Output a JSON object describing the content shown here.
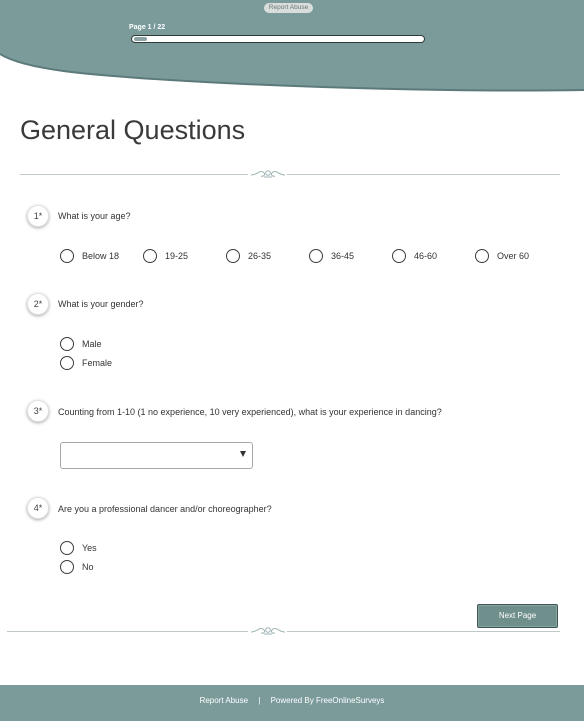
{
  "header": {
    "report_abuse": "Report Abuse",
    "page_label": "Page 1 / 22",
    "progress_fraction": 0.045
  },
  "title": "General Questions",
  "questions": [
    {
      "number": "1*",
      "text": "What is your age?",
      "options": [
        "Below 18",
        "19-25",
        "26-35",
        "36-45",
        "46-60",
        "Over 60"
      ]
    },
    {
      "number": "2*",
      "text": "What is your gender?",
      "options": [
        "Male",
        "Female"
      ]
    },
    {
      "number": "3*",
      "text": "Counting from 1-10 (1 no experience, 10 very experienced), what is your experience in dancing?",
      "select_value": ""
    },
    {
      "number": "4*",
      "text": "Are you a professional dancer and/or choreographer?",
      "options": [
        "Yes",
        "No"
      ]
    }
  ],
  "next_button": "Next Page",
  "footer": {
    "report_abuse": "Report Abuse",
    "separator": "|",
    "powered_by": "Powered By FreeOnlineSurveys"
  },
  "colors": {
    "header_bg": "#7b9b9b",
    "accent": "#6f8f8c"
  }
}
